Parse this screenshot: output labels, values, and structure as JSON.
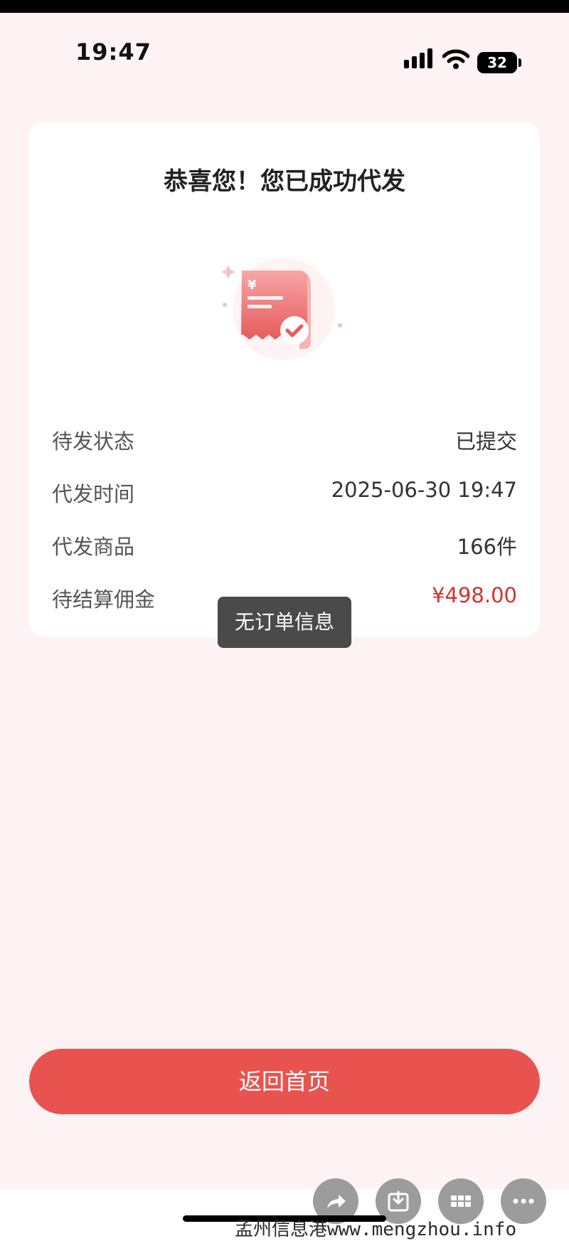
{
  "status_bar": {
    "time": "19:47",
    "battery": "32"
  },
  "card": {
    "title": "恭喜您！您已成功代发",
    "rows": [
      {
        "label": "待发状态",
        "value": "已提交"
      },
      {
        "label": "代发时间",
        "value": "2025-06-30 19:47"
      },
      {
        "label": "代发商品",
        "value": "166件"
      },
      {
        "label": "待结算佣金",
        "value": "¥498.00"
      }
    ]
  },
  "toast": {
    "text": "无订单信息"
  },
  "buttons": {
    "return_home": "返回首页"
  },
  "watermark": "孟州信息港www.mengzhou.info",
  "colors": {
    "accent": "#e9534f",
    "price": "#d2322d",
    "background": "#fdf3f4"
  }
}
